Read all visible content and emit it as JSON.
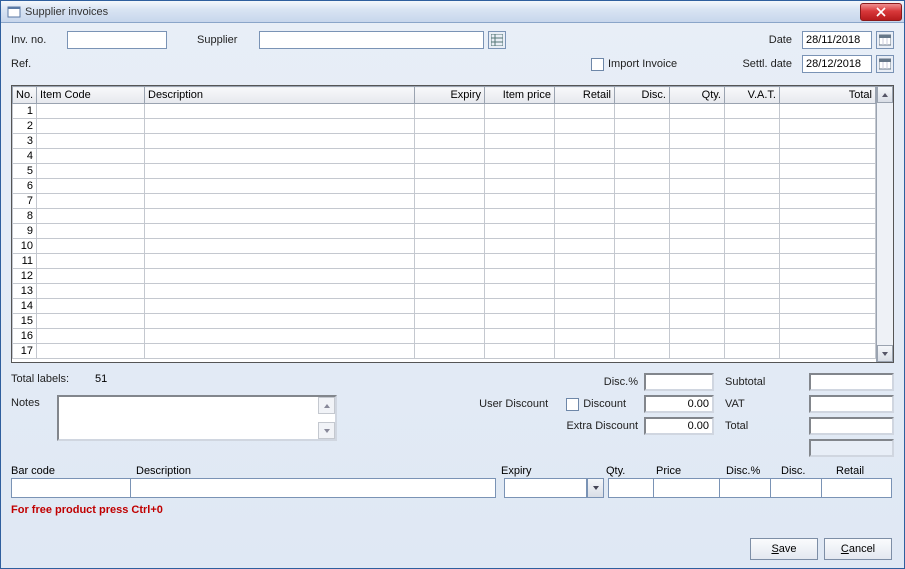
{
  "title": "Supplier invoices",
  "header": {
    "inv_no_label": "Inv. no.",
    "inv_no": "",
    "supplier_label": "Supplier",
    "supplier": "",
    "ref_label": "Ref.",
    "import_invoice_label": "Import Invoice",
    "date_label": "Date",
    "date": "28/11/2018",
    "settl_date_label": "Settl. date",
    "settl_date": "28/12/2018"
  },
  "columns": {
    "no": "No.",
    "item_code": "Item Code",
    "description": "Description",
    "expiry": "Expiry",
    "item_price": "Item price",
    "retail": "Retail",
    "disc": "Disc.",
    "qty": "Qty.",
    "vat": "V.A.T.",
    "total": "Total"
  },
  "rows": [
    {
      "no": "1"
    },
    {
      "no": "2"
    },
    {
      "no": "3"
    },
    {
      "no": "4"
    },
    {
      "no": "5"
    },
    {
      "no": "6"
    },
    {
      "no": "7"
    },
    {
      "no": "8"
    },
    {
      "no": "9"
    },
    {
      "no": "10"
    },
    {
      "no": "11"
    },
    {
      "no": "12"
    },
    {
      "no": "13"
    },
    {
      "no": "14"
    },
    {
      "no": "15"
    },
    {
      "no": "16"
    },
    {
      "no": "17"
    }
  ],
  "footer": {
    "total_labels_label": "Total labels:",
    "total_labels_value": "51",
    "notes_label": "Notes",
    "disc_pct_label": "Disc.%",
    "disc_pct": "",
    "user_discount_label": "User Discount",
    "discount_chk_label": "Discount",
    "discount_val": "0.00",
    "extra_discount_label": "Extra Discount",
    "extra_discount_val": "0.00",
    "subtotal_label": "Subtotal",
    "subtotal": "",
    "vat_label": "VAT",
    "vat": "",
    "total_label": "Total",
    "total": ""
  },
  "entry": {
    "barcode_label": "Bar code",
    "description_label": "Description",
    "expiry_label": "Expiry",
    "qty_label": "Qty.",
    "price_label": "Price",
    "disc_pct_label": "Disc.%",
    "disc_label": "Disc.",
    "retail_label": "Retail"
  },
  "hint": "For free product press Ctrl+0",
  "buttons": {
    "save": "Save",
    "cancel": "Cancel"
  }
}
